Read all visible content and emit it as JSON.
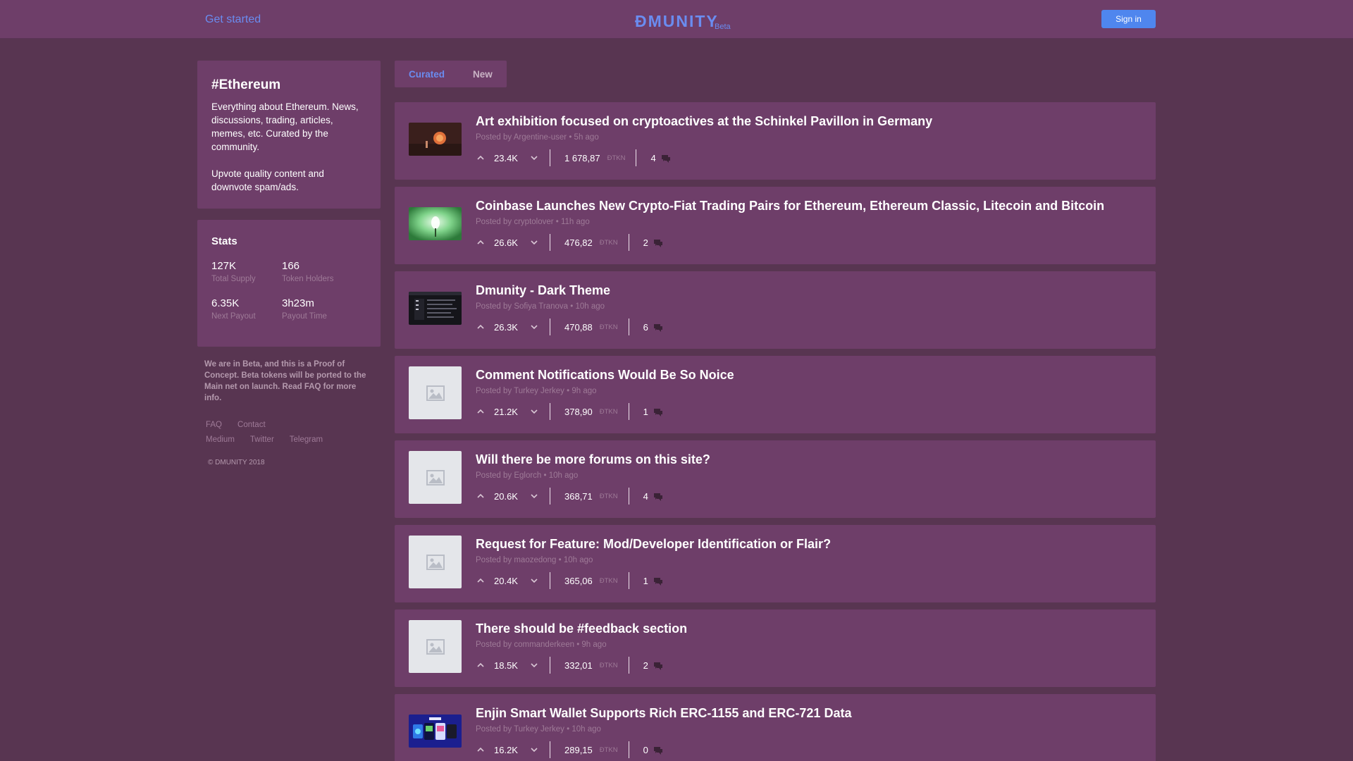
{
  "header": {
    "get_started": "Get started",
    "logo": "ÐMUNITY",
    "beta": "Beta",
    "sign_in": "Sign in"
  },
  "sidebar": {
    "title": "#Ethereum",
    "description": "Everything about Ethereum. News, discussions, trading, articles, memes, etc. Curated by the community.",
    "note": "Upvote quality content and downvote spam/ads.",
    "stats": {
      "title": "Stats",
      "total_supply": {
        "value": "127K",
        "label": "Total Supply"
      },
      "token_holders": {
        "value": "166",
        "label": "Token Holders"
      },
      "next_payout": {
        "value": "6.35K",
        "label": "Next Payout"
      },
      "payout_time": {
        "value": "3h23m",
        "label": "Payout Time"
      }
    },
    "beta_note": "We are in Beta, and this is a Proof of Concept. Beta tokens will be ported to the Main net on launch. Read FAQ for more info.",
    "links": [
      "FAQ",
      "Contact",
      "Medium",
      "Twitter",
      "Telegram"
    ],
    "copyright": "© DMUNITY 2018"
  },
  "tabs": [
    "Curated",
    "New"
  ],
  "active_tab": "Curated",
  "token_unit": "ÐTKN",
  "posts": [
    {
      "title": "Art exhibition focused on cryptoactives at the Schinkel Pavillon in Germany",
      "meta": "Posted by Argentine-user • 5h ago",
      "score": "23.4K",
      "tokens": "1 678,87",
      "comments": "4",
      "thumb": "art"
    },
    {
      "title": "Coinbase Launches New Crypto-Fiat Trading Pairs for Ethereum, Ethereum Classic, Litecoin and Bitcoin",
      "meta": "Posted by cryptolover • 11h ago",
      "score": "26.6K",
      "tokens": "476,82",
      "comments": "2",
      "thumb": "green"
    },
    {
      "title": "Dmunity - Dark Theme",
      "meta": "Posted by Sofiya Tranova • 10h ago",
      "score": "26.3K",
      "tokens": "470,88",
      "comments": "6",
      "thumb": "dark"
    },
    {
      "title": "Comment Notifications Would Be So Noice",
      "meta": "Posted by Turkey Jerkey • 9h ago",
      "score": "21.2K",
      "tokens": "378,90",
      "comments": "1",
      "thumb": "placeholder"
    },
    {
      "title": "Will there be more forums on this site?",
      "meta": "Posted by Eglorch • 10h ago",
      "score": "20.6K",
      "tokens": "368,71",
      "comments": "4",
      "thumb": "placeholder"
    },
    {
      "title": "Request for Feature: Mod/Developer Identification or Flair?",
      "meta": "Posted by maozedong • 10h ago",
      "score": "20.4K",
      "tokens": "365,06",
      "comments": "1",
      "thumb": "placeholder"
    },
    {
      "title": "There should be #feedback section",
      "meta": "Posted by commanderkeen • 9h ago",
      "score": "18.5K",
      "tokens": "332,01",
      "comments": "2",
      "thumb": "placeholder"
    },
    {
      "title": "Enjin Smart Wallet Supports Rich ERC-1155 and ERC-721 Data",
      "meta": "Posted by Turkey Jerkey • 10h ago",
      "score": "16.2K",
      "tokens": "289,15",
      "comments": "0",
      "thumb": "enjin"
    }
  ]
}
